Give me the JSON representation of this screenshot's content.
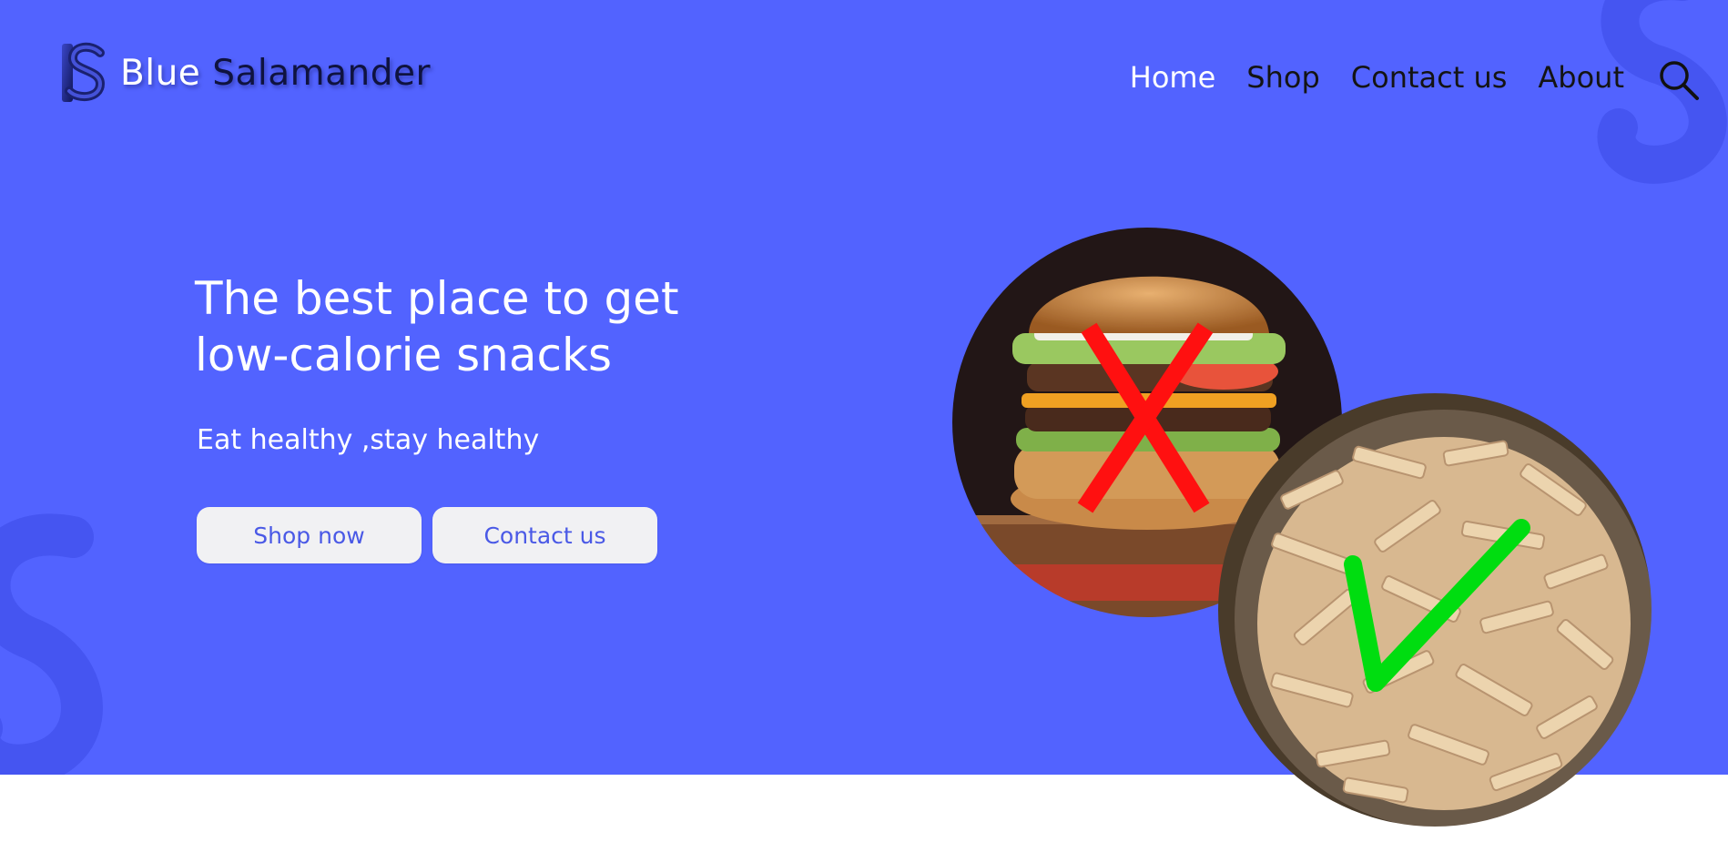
{
  "header": {
    "brand_first": "Blue",
    "brand_second": "Salamander",
    "nav": [
      {
        "label": "Home",
        "active": true
      },
      {
        "label": "Shop",
        "active": false
      },
      {
        "label": "Contact us",
        "active": false
      },
      {
        "label": "About",
        "active": false
      }
    ],
    "search_icon": "search-icon"
  },
  "hero": {
    "headline_line1": "The best place to get",
    "headline_line2": "low-calorie snacks",
    "tagline": "Eat healthy ,stay healthy",
    "buttons": {
      "shop": "Shop now",
      "contact": "Contact us"
    },
    "images": {
      "unhealthy": {
        "depicts": "burger",
        "mark": "red-cross-icon"
      },
      "healthy": {
        "depicts": "noodles",
        "mark": "green-check-icon"
      }
    }
  },
  "colors": {
    "hero_background": "#5263ff",
    "page_background": "#ffffff",
    "button_background": "#f1f1f3",
    "button_text": "#4a59e6",
    "brand_dark": "#0f1340",
    "cross": "#ff0000",
    "check": "#00dd00"
  }
}
